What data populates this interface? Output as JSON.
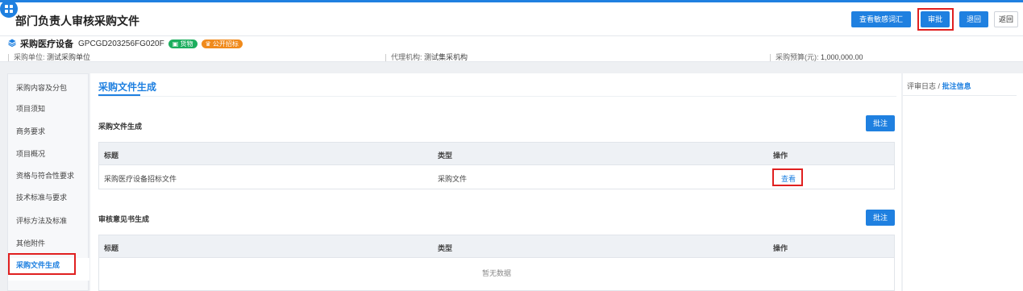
{
  "header": {
    "title": "部门负责人审核采购文件",
    "buttons": {
      "sensitive_words": "查看敏感词汇",
      "approve": "审批",
      "back": "退回",
      "return": "返回"
    }
  },
  "project": {
    "name": "采购医疗设备",
    "code": "GPCGD203256FG020F",
    "tags": [
      "货物",
      "公开招标"
    ],
    "purchasing_unit_label": "采购单位:",
    "purchasing_unit": "测试采购单位",
    "agency_label": "代理机构:",
    "agency": "测试集采机构",
    "budget_label": "采购预算(元):",
    "budget": "1,000,000.00"
  },
  "sidebar": {
    "items": [
      "采购内容及分包",
      "项目须知",
      "商务要求",
      "项目概况",
      "资格与符合性要求",
      "技术标准与要求",
      "评标方法及标准",
      "其他附件",
      "采购文件生成"
    ],
    "active_index": 8
  },
  "main": {
    "tab": "采购文件生成",
    "section1": {
      "title": "采购文件生成",
      "annotate": "批注",
      "columns": [
        "标题",
        "类型",
        "操作"
      ],
      "rows": [
        {
          "title": "采购医疗设备招标文件",
          "type": "采购文件",
          "action": "查看"
        }
      ]
    },
    "section2": {
      "title": "审核意见书生成",
      "annotate": "批注",
      "columns": [
        "标题",
        "类型",
        "操作"
      ],
      "empty": "暂无数据"
    }
  },
  "right_panel": {
    "tab_log": "评审日志",
    "separator": "/",
    "tab_annotations": "批注信息"
  },
  "colors": {
    "primary": "#1f80e0",
    "highlight": "#e02020",
    "tag_green": "#1cae5e",
    "tag_orange": "#f08a1c"
  },
  "icons": [
    "menu-grid-icon",
    "layers-icon",
    "box-icon",
    "gavel-icon"
  ]
}
